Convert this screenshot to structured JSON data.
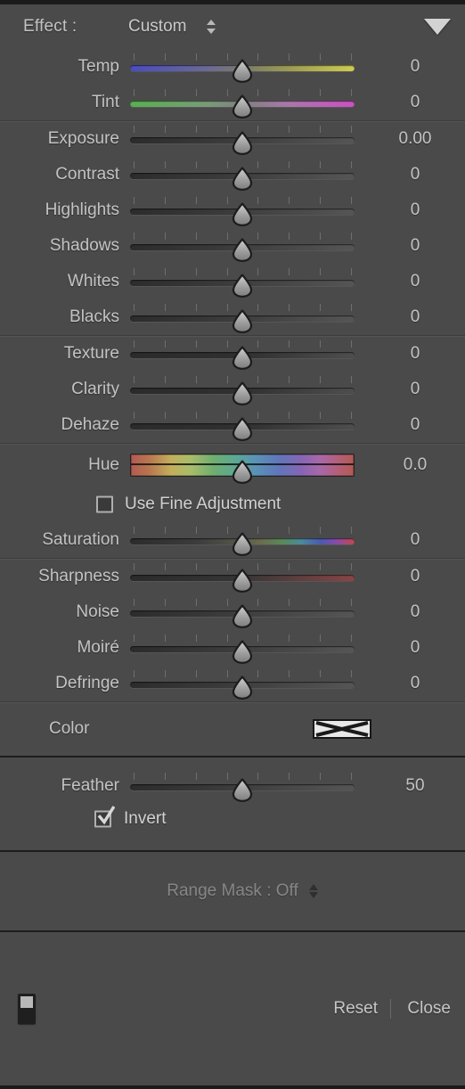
{
  "panel": {
    "effect_label": "Effect :",
    "effect_value": "Custom"
  },
  "groups": [
    {
      "name": "white-balance",
      "sliders": [
        {
          "label": "Temp",
          "value": "0",
          "pos": 50,
          "track": "t-temp"
        },
        {
          "label": "Tint",
          "value": "0",
          "pos": 50,
          "track": "t-tint"
        }
      ]
    },
    {
      "name": "tone",
      "sliders": [
        {
          "label": "Exposure",
          "value": "0.00",
          "pos": 50,
          "track": "t-neutral"
        },
        {
          "label": "Contrast",
          "value": "0",
          "pos": 50,
          "track": "t-neutral"
        },
        {
          "label": "Highlights",
          "value": "0",
          "pos": 50,
          "track": "t-neutral"
        },
        {
          "label": "Shadows",
          "value": "0",
          "pos": 50,
          "track": "t-neutral"
        },
        {
          "label": "Whites",
          "value": "0",
          "pos": 50,
          "track": "t-neutral"
        },
        {
          "label": "Blacks",
          "value": "0",
          "pos": 50,
          "track": "t-neutral"
        }
      ]
    },
    {
      "name": "presence",
      "sliders": [
        {
          "label": "Texture",
          "value": "0",
          "pos": 50,
          "track": "t-dark"
        },
        {
          "label": "Clarity",
          "value": "0",
          "pos": 50,
          "track": "t-dark"
        },
        {
          "label": "Dehaze",
          "value": "0",
          "pos": 50,
          "track": "t-dark"
        }
      ]
    },
    {
      "name": "color",
      "hue": {
        "label": "Hue",
        "value": "0.0",
        "pos": 50
      },
      "fine_adjustment": {
        "label": "Use Fine Adjustment",
        "checked": false
      },
      "sliders": [
        {
          "label": "Saturation",
          "value": "0",
          "pos": 50,
          "track": "t-sat"
        }
      ]
    },
    {
      "name": "detail",
      "sliders": [
        {
          "label": "Sharpness",
          "value": "0",
          "pos": 50,
          "track": "t-sharp"
        },
        {
          "label": "Noise",
          "value": "0",
          "pos": 50,
          "track": "t-neutral"
        },
        {
          "label": "Moiré",
          "value": "0",
          "pos": 50,
          "track": "t-neutral"
        },
        {
          "label": "Defringe",
          "value": "0",
          "pos": 50,
          "track": "t-neutral"
        }
      ]
    }
  ],
  "color_row": {
    "label": "Color",
    "swatch_state": "none"
  },
  "mask": {
    "feather": {
      "label": "Feather",
      "value": "50",
      "pos": 50
    },
    "invert": {
      "label": "Invert",
      "checked": true
    }
  },
  "range_mask": {
    "text": "Range Mask : Off"
  },
  "footer": {
    "reset_label": "Reset",
    "close_label": "Close",
    "toggle_icon": "mask-toggle-icon"
  },
  "colors": {
    "background": "#4a4a4a",
    "text": "#c3c3c3",
    "dim_text": "#868686",
    "divider": "#3c3c3c",
    "edge": "#1b1b1b"
  }
}
